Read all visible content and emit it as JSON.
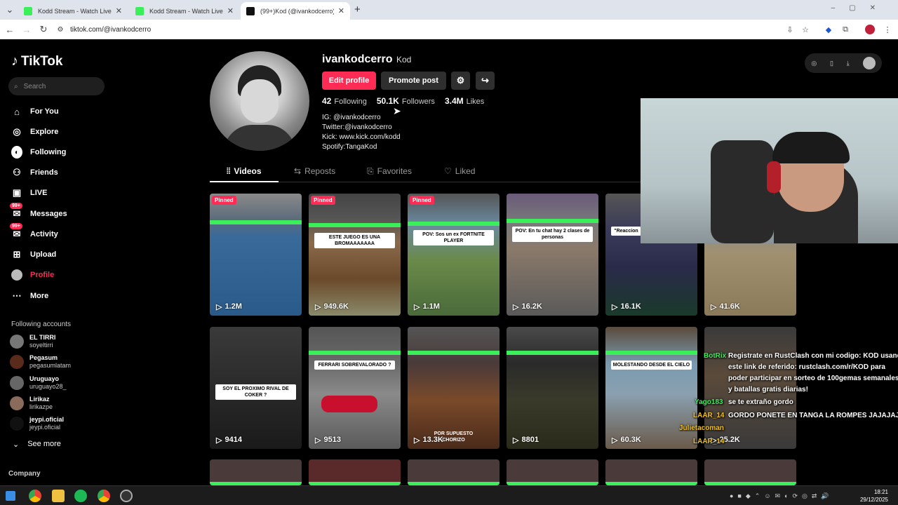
{
  "browser": {
    "tabs": [
      {
        "label": "Kodd Stream - Watch Live on K",
        "active": false
      },
      {
        "label": "Kodd Stream - Watch Live on K",
        "active": false
      },
      {
        "label": "(99+)Kod (@ivankodcerro) | Tik",
        "active": true
      }
    ],
    "new_tab": "+",
    "url": "tiktok.com/@ivankodcerro"
  },
  "sidebar": {
    "logo": "TikTok",
    "search_placeholder": "Search",
    "nav": [
      {
        "label": "For You",
        "icon": "home-icon"
      },
      {
        "label": "Explore",
        "icon": "compass-icon"
      },
      {
        "label": "Following",
        "icon": "following-icon"
      },
      {
        "label": "Friends",
        "icon": "friends-icon"
      },
      {
        "label": "LIVE",
        "icon": "live-icon"
      },
      {
        "label": "Messages",
        "icon": "messages-icon",
        "badge": "99+"
      },
      {
        "label": "Activity",
        "icon": "activity-icon",
        "badge": "99+"
      },
      {
        "label": "Upload",
        "icon": "upload-icon"
      },
      {
        "label": "Profile",
        "icon": "profile-icon",
        "active": true
      },
      {
        "label": "More",
        "icon": "more-icon"
      }
    ],
    "following_title": "Following accounts",
    "accounts": [
      {
        "name": "EL TIRRI",
        "handle": "soyeltirri"
      },
      {
        "name": "Pegasum",
        "handle": "pegasumlatam"
      },
      {
        "name": "Uruguayo",
        "handle": "uruguayo28_"
      },
      {
        "name": "Lirikaz",
        "handle": "lirikazpe"
      },
      {
        "name": "jeypi.oficial",
        "handle": "jeypi.oficial"
      }
    ],
    "see_more": "See more",
    "company": "Company"
  },
  "profile": {
    "username": "ivankodcerro",
    "nickname": "Kod",
    "edit_button": "Edit profile",
    "promote_button": "Promote post",
    "following_count": "42",
    "following_label": "Following",
    "followers_count": "50.1K",
    "followers_label": "Followers",
    "likes_count": "3.4M",
    "likes_label": "Likes",
    "bio": [
      "IG: @ivankodcerro",
      "Twitter:@ivankodcerro",
      "Kick: www.kick.com/kodd",
      "Spotify:TangaKod"
    ],
    "tabs": [
      "Videos",
      "Reposts",
      "Favorites",
      "Liked"
    ]
  },
  "videos_row1": [
    {
      "views": "1.2M",
      "pinned": "Pinned",
      "caption": ""
    },
    {
      "views": "949.6K",
      "pinned": "Pinned",
      "caption": "ESTE JUEGO ES UNA BROMAAAAAAA"
    },
    {
      "views": "1.1M",
      "pinned": "Pinned",
      "caption": "POV: Sos un ex FORTNITE PLAYER"
    },
    {
      "views": "16.2K",
      "pinned": "",
      "caption": "POV: En tu chat hay 2 clases de personas"
    },
    {
      "views": "16.1K",
      "pinned": "",
      "caption": "\"Reaccion"
    },
    {
      "views": "41.6K",
      "pinned": "",
      "caption": ""
    }
  ],
  "videos_row2": [
    {
      "views": "9414",
      "caption": "SOY EL PROXIMO RIVAL DE COKER ?"
    },
    {
      "views": "9513",
      "caption": "FERRARI SOBREVALORADO ?"
    },
    {
      "views": "13.3K",
      "caption": "POR SUPUESTO CHORIZO"
    },
    {
      "views": "8801",
      "caption": ""
    },
    {
      "views": "60.3K",
      "caption": "MOLESTANDO DESDE EL CIELO"
    },
    {
      "views": "25.2K",
      "caption": ""
    }
  ],
  "chat": [
    {
      "user": "BotRix",
      "text": "Registrate en RustClash con mi codigo: KOD usando",
      "color": "#3aef5a"
    },
    {
      "user": "",
      "text": "este link de referido: rustclash.com/r/KOD para",
      "color": ""
    },
    {
      "user": "",
      "text": "poder participar en sorteo de 100gemas semanales",
      "color": ""
    },
    {
      "user": "",
      "text": "y batallas gratis diarias!",
      "color": ""
    },
    {
      "user": "Yago183",
      "text": "se te extraño gordo",
      "color": "#3aef5a"
    },
    {
      "user": "LAAR_14",
      "text": "GORDO PONETE EN TANGA LA ROMPES JAJAJAJA",
      "color": "#f0c020"
    },
    {
      "user": "Julietacoman",
      "text": "",
      "color": "#f0c020"
    },
    {
      "user": "LAAR_14",
      "text": "",
      "color": "#f0c020"
    }
  ],
  "taskbar": {
    "time": "18:21",
    "date": "29/12/2025"
  },
  "colors": {
    "accent": "#fe2c55",
    "kick_green": "#3aef5a"
  }
}
